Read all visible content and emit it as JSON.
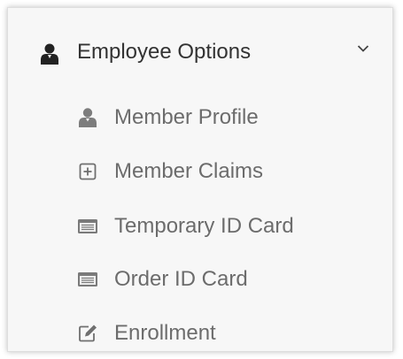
{
  "menu": {
    "header": {
      "label": "Employee Options",
      "icon": "user-icon",
      "toggle_icon": "chevron-down-icon"
    },
    "items": [
      {
        "label": "Member Profile",
        "icon": "user-icon"
      },
      {
        "label": "Member Claims",
        "icon": "plus-square-icon"
      },
      {
        "label": "Temporary ID Card",
        "icon": "id-card-icon"
      },
      {
        "label": "Order ID Card",
        "icon": "id-card-icon"
      },
      {
        "label": "Enrollment",
        "icon": "edit-icon"
      }
    ]
  }
}
